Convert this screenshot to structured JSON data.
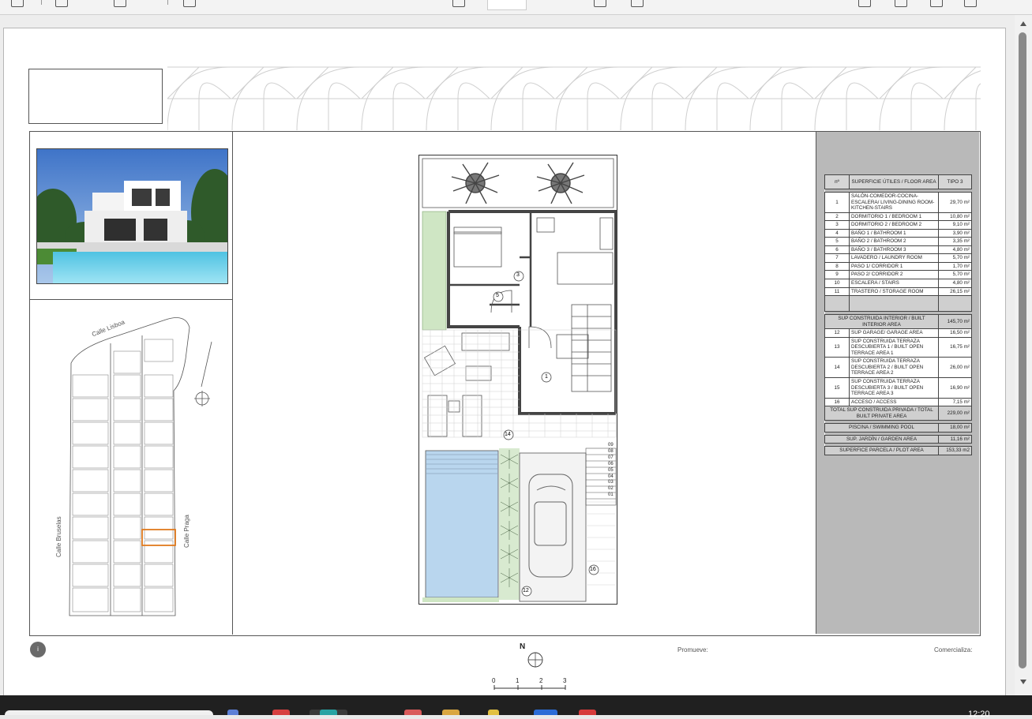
{
  "titlebar": {
    "clock": "12:20"
  },
  "sitemap": {
    "street_top": "Calle Lisboa",
    "street_left": "Calle Bruselas",
    "street_right": "Calle Praga"
  },
  "plan": {
    "room_labels": [
      "3",
      "5",
      "1",
      "14",
      "12",
      "16"
    ],
    "stair_steps": [
      "09",
      "08",
      "07",
      "06",
      "05",
      "04",
      "03",
      "02",
      "01"
    ]
  },
  "table": {
    "header": {
      "num": "nº",
      "area": "SUPERFICIE ÚTILES / FLOOR AREA",
      "type": "TIPO 3"
    },
    "rooms": [
      {
        "n": "1",
        "label": "SALÓN-COMEDOR-COCINA-ESCALERA/ LIVING-DINING ROOM-KITCHEN-STAIRS",
        "value": "29,70 m²"
      },
      {
        "n": "2",
        "label": "DORMITORIO 1 / BEDROOM 1",
        "value": "10,80 m²"
      },
      {
        "n": "3",
        "label": "DORMITORIO 2 / BEDROOM 2",
        "value": "9,10 m²"
      },
      {
        "n": "4",
        "label": "BAÑO 1 / BATHROOM 1",
        "value": "3,90 m²"
      },
      {
        "n": "5",
        "label": "BAÑO 2 / BATHROOM 2",
        "value": "3,35 m²"
      },
      {
        "n": "6",
        "label": "BAÑO 3 / BATHROOM 3",
        "value": "4,80 m²"
      },
      {
        "n": "7",
        "label": "LAVADERO / LAUNDRY ROOM",
        "value": "5,70 m²"
      },
      {
        "n": "8",
        "label": "PASO 1/ CORRIDOR 1",
        "value": "1,70 m²"
      },
      {
        "n": "9",
        "label": "PASO 2/ CORRIDOR 2",
        "value": "5,70 m²"
      },
      {
        "n": "10",
        "label": "ESCALERA / STAIRS",
        "value": "4,80 m²"
      },
      {
        "n": "11",
        "label": "TRASTERO / STORAGE ROOM",
        "value": "26,15 m²"
      }
    ],
    "built_interior": {
      "label": "SUP CONSTRUIDA INTERIOR / BUILT INTERIOR AREA",
      "value": "145,70 m²"
    },
    "built_rows": [
      {
        "n": "12",
        "label": "SUP GARAGE/ GARAGE AREA",
        "value": "16,50 m²"
      },
      {
        "n": "13",
        "label": "SUP CONSTRUIDA TERRAZA DESCUBIERTA 1 / BUILT OPEN TERRACE AREA 1",
        "value": "16,75 m²"
      },
      {
        "n": "14",
        "label": "SUP CONSTRUIDA TERRAZA DESCUBIERTA 2 / BUILT OPEN TERRACE AREA 2",
        "value": "26,00 m²"
      },
      {
        "n": "15",
        "label": "SUP CONSTRUIDA TERRAZA DESCUBIERTA 3 / BUILT OPEN TERRACE AREA 3",
        "value": "16,90 m²"
      },
      {
        "n": "16",
        "label": "ACCESO / ACCESS",
        "value": "7,15 m²"
      }
    ],
    "total_private": {
      "label": "TOTAL SUP CONSTRUIDA PRIVADA / TOTAL BUILT PRIVATE AREA",
      "value": "229,00 m²"
    },
    "pool": {
      "label": "PISCINA / SWIMMING POOL",
      "value": "18,00 m²"
    },
    "garden": {
      "label": "SUP. JARDÍN / GARDEN AREA",
      "value": "11,16 m²"
    },
    "plot": {
      "label": "SUPERFICE PARCELA / PLOT AREA",
      "value": "153,33 m2"
    }
  },
  "footer": {
    "info_icon": "i",
    "north": "N",
    "promoter": "Promueve:",
    "marketer": "Comercializa:",
    "scale": [
      "0",
      "1",
      "2",
      "3"
    ]
  },
  "icons": {
    "info": "info-icon",
    "compass": "north-arrow-icon",
    "palm": "palm-tree-icon",
    "car": "car-icon",
    "taskbar": [
      "chrome-icon",
      "edge-icon",
      "files-icon",
      "mail-icon",
      "store-icon",
      "word-icon",
      "opera-icon"
    ]
  },
  "colors": {
    "garden": "#cfe6c4",
    "pool": "#b9d6ee",
    "panel": "#b9b9b9",
    "highlight": "#e07a1e"
  }
}
